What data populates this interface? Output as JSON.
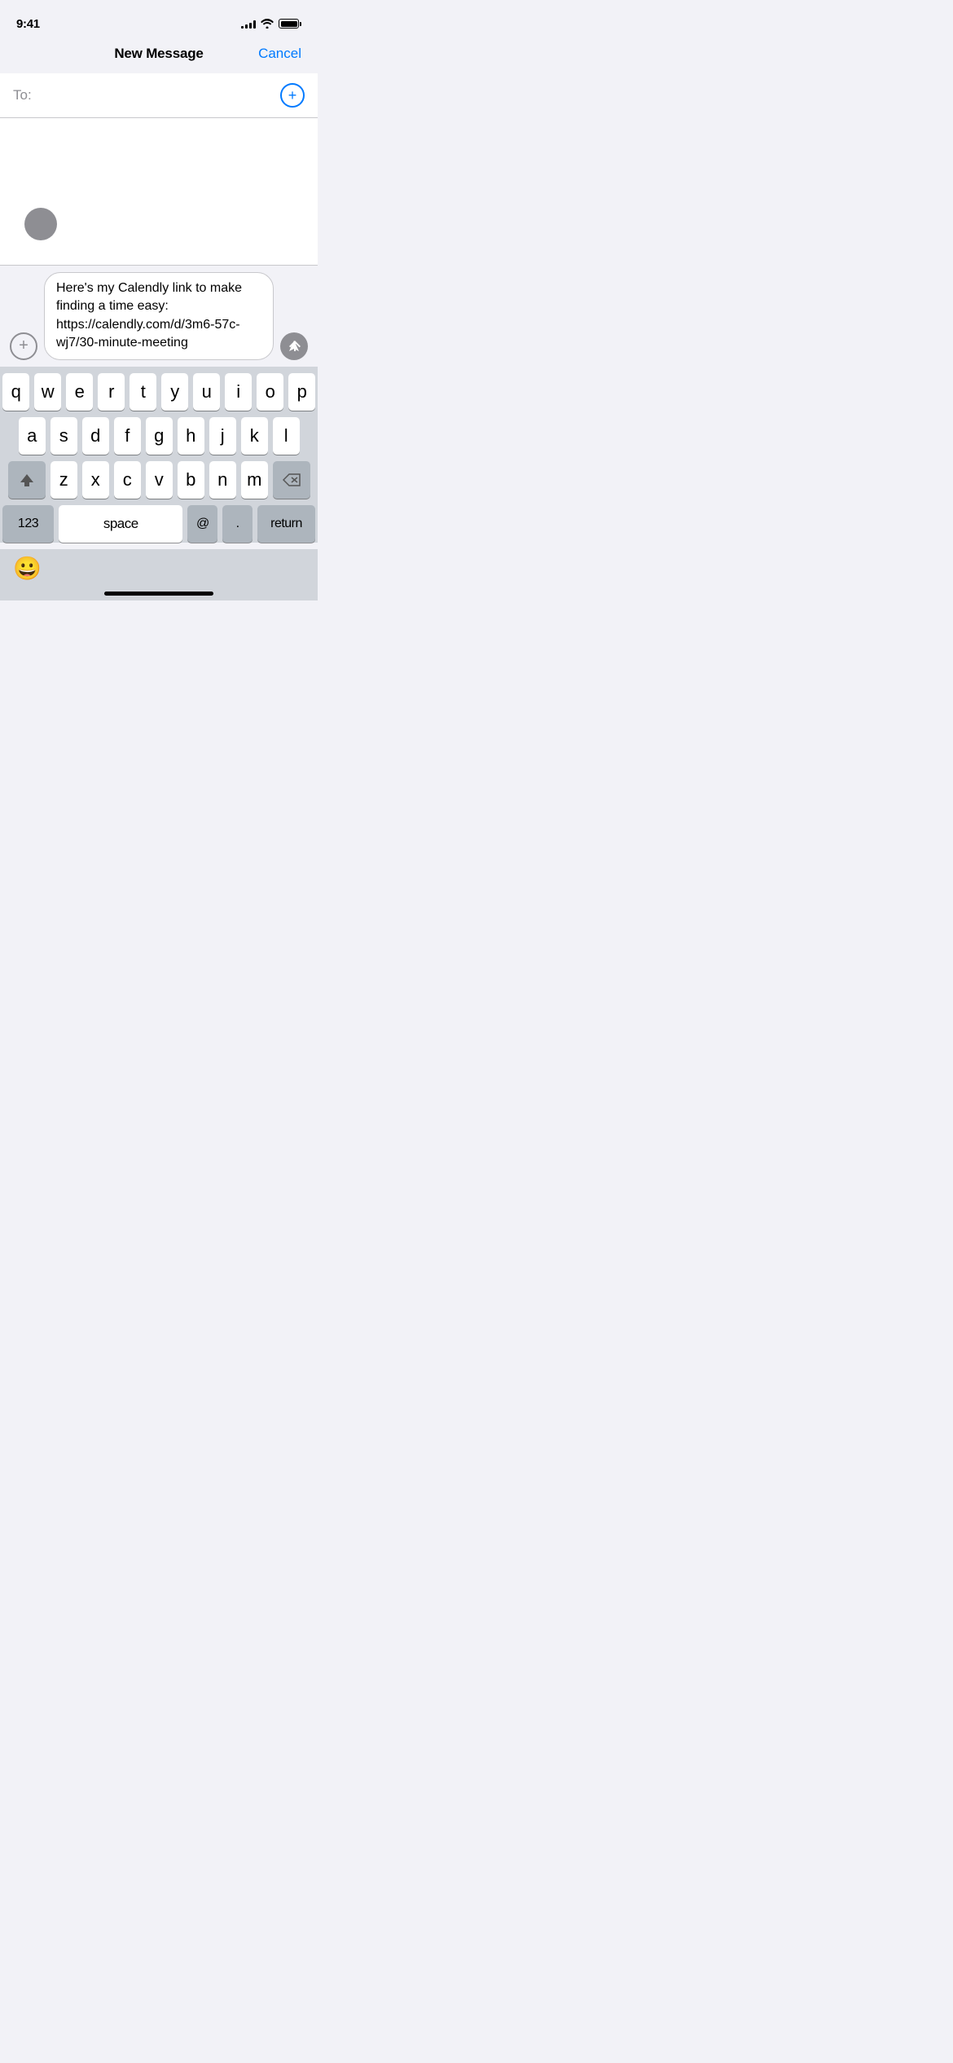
{
  "statusBar": {
    "time": "9:41",
    "signalBars": [
      3,
      5,
      7,
      9,
      11
    ],
    "batteryPercent": 100
  },
  "header": {
    "title": "New Message",
    "cancelLabel": "Cancel"
  },
  "toField": {
    "label": "To:",
    "placeholder": ""
  },
  "messageInput": {
    "text": "Here's my Calendly link to make finding a time easy: https://calendly.com/d/3m6-57c-wj7/30-minute-meeting"
  },
  "attachButton": {
    "label": "+"
  },
  "keyboard": {
    "rows": [
      [
        "q",
        "w",
        "e",
        "r",
        "t",
        "y",
        "u",
        "i",
        "o",
        "p"
      ],
      [
        "a",
        "s",
        "d",
        "f",
        "g",
        "h",
        "j",
        "k",
        "l"
      ],
      [
        "z",
        "x",
        "c",
        "v",
        "b",
        "n",
        "m"
      ]
    ],
    "bottomRow": {
      "numbers": "123",
      "space": "space",
      "at": "@",
      "period": ".",
      "return": "return"
    }
  },
  "emojiButton": {
    "symbol": "😀"
  },
  "homeIndicator": {}
}
